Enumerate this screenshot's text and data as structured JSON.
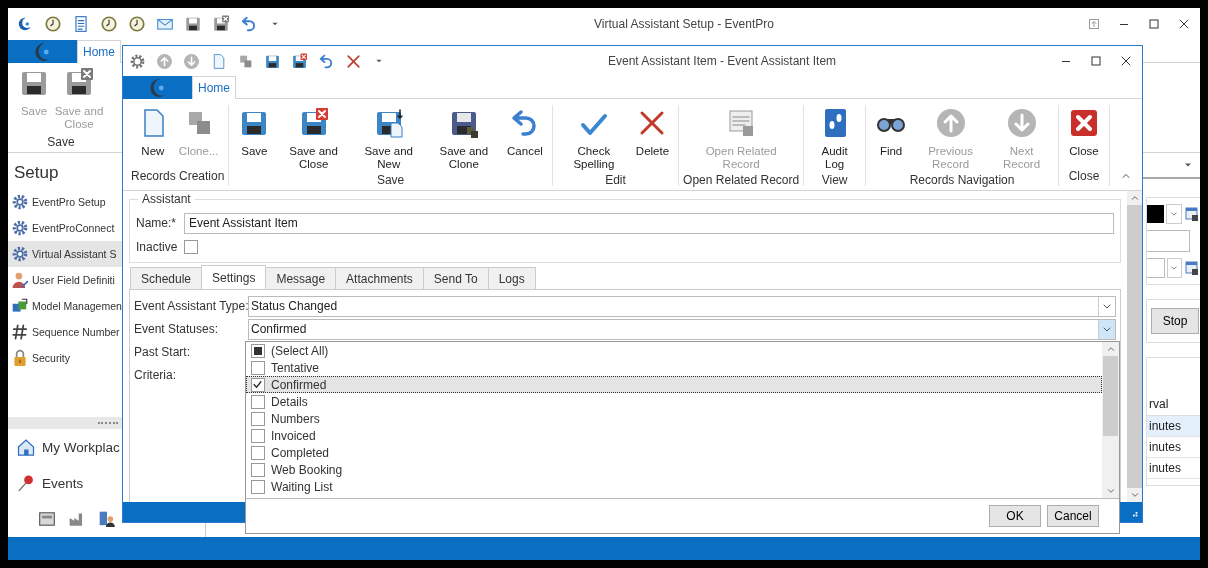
{
  "window": {
    "title": "Virtual Assistant Setup - EventPro"
  },
  "main_ribbon": {
    "tabs": [
      {
        "label": "Home",
        "selected": true
      }
    ],
    "groups": [
      {
        "label": "Save",
        "buttons": [
          {
            "label": "Save",
            "kind": "save",
            "disabled": true
          },
          {
            "label": "Save and Close",
            "kind": "save-close",
            "disabled": true
          }
        ]
      }
    ]
  },
  "sidebar": {
    "title": "Setup",
    "items": [
      {
        "label": "EventPro Setup",
        "kind": "gear",
        "selected": false
      },
      {
        "label": "EventProConnect",
        "kind": "gear",
        "selected": false
      },
      {
        "label": "Virtual Assistant S",
        "kind": "gear",
        "selected": true
      },
      {
        "label": "User Field Definiti",
        "kind": "person",
        "selected": false
      },
      {
        "label": "Model Managemen",
        "kind": "model",
        "selected": false
      },
      {
        "label": "Sequence Number",
        "kind": "hash",
        "selected": false
      },
      {
        "label": "Security",
        "kind": "lock",
        "selected": false
      }
    ],
    "navigation": [
      {
        "label": "My Workplac",
        "kind": "home"
      },
      {
        "label": "Events",
        "kind": "pin"
      }
    ]
  },
  "background_panel": {
    "stop_button": "Stop",
    "column_header": "rval",
    "rows": [
      {
        "cell": "inutes",
        "selected": true
      },
      {
        "cell": "inutes",
        "selected": false
      },
      {
        "cell": "inutes",
        "selected": false
      }
    ]
  },
  "dialog": {
    "title": "Event Assistant Item - Event Assistant Item",
    "ribbon": {
      "tabs": [
        {
          "label": "Home",
          "selected": true
        }
      ],
      "groups": [
        {
          "label": "Records Creation",
          "buttons": [
            {
              "label": "New",
              "kind": "page",
              "disabled": false
            },
            {
              "label": "Clone...",
              "kind": "cubes",
              "disabled": true
            }
          ]
        },
        {
          "label": "Save",
          "buttons": [
            {
              "label": "Save",
              "kind": "save",
              "disabled": false
            },
            {
              "label": "Save and Close",
              "kind": "save-close",
              "disabled": false
            },
            {
              "label": "Save and New",
              "kind": "save-new",
              "disabled": false
            },
            {
              "label": "Save and Clone",
              "kind": "save-clone",
              "disabled": false
            },
            {
              "label": "Cancel",
              "kind": "undo",
              "disabled": false
            }
          ]
        },
        {
          "label": "Edit",
          "buttons": [
            {
              "label": "Check Spelling",
              "kind": "spell",
              "disabled": false
            },
            {
              "label": "Delete",
              "kind": "delete",
              "disabled": false
            }
          ]
        },
        {
          "label": "Open Related Record",
          "buttons": [
            {
              "label": "Open Related Record",
              "kind": "related",
              "disabled": true
            }
          ]
        },
        {
          "label": "View",
          "buttons": [
            {
              "label": "Audit Log",
              "kind": "book",
              "disabled": false
            }
          ]
        },
        {
          "label": "Records Navigation",
          "buttons": [
            {
              "label": "Find",
              "kind": "binoculars",
              "disabled": false
            },
            {
              "label": "Previous Record",
              "kind": "up",
              "disabled": true
            },
            {
              "label": "Next Record",
              "kind": "down",
              "disabled": true
            }
          ]
        },
        {
          "label": "Close",
          "buttons": [
            {
              "label": "Close",
              "kind": "close",
              "disabled": false
            }
          ]
        }
      ]
    },
    "assistant": {
      "legend": "Assistant",
      "name_label": "Name:*",
      "name_value": "Event Assistant Item",
      "inactive_label": "Inactive",
      "inactive": false
    },
    "tabs": [
      {
        "label": "Schedule",
        "selected": false
      },
      {
        "label": "Settings",
        "selected": true
      },
      {
        "label": "Message",
        "selected": false
      },
      {
        "label": "Attachments",
        "selected": false
      },
      {
        "label": "Send To",
        "selected": false
      },
      {
        "label": "Logs",
        "selected": false
      }
    ],
    "settings": {
      "type_label": "Event Assistant Type:",
      "type_value": "Status Changed",
      "statuses_label": "Event Statuses:",
      "statuses_value": "Confirmed",
      "past_start_label": "Past Start:",
      "criteria_label": "Criteria:"
    },
    "status_popup": {
      "items": [
        {
          "label": "(Select All)",
          "checked": false,
          "indeterminate": true,
          "selected": false
        },
        {
          "label": "Tentative",
          "checked": false,
          "indeterminate": false,
          "selected": false
        },
        {
          "label": "Confirmed",
          "checked": true,
          "indeterminate": false,
          "selected": true
        },
        {
          "label": "Details",
          "checked": false,
          "indeterminate": false,
          "selected": false
        },
        {
          "label": "Numbers",
          "checked": false,
          "indeterminate": false,
          "selected": false
        },
        {
          "label": "Invoiced",
          "checked": false,
          "indeterminate": false,
          "selected": false
        },
        {
          "label": "Completed",
          "checked": false,
          "indeterminate": false,
          "selected": false
        },
        {
          "label": "Web Booking",
          "checked": false,
          "indeterminate": false,
          "selected": false
        },
        {
          "label": "Waiting List",
          "checked": false,
          "indeterminate": false,
          "selected": false
        }
      ],
      "buttons": [
        "OK",
        "Cancel"
      ]
    }
  }
}
